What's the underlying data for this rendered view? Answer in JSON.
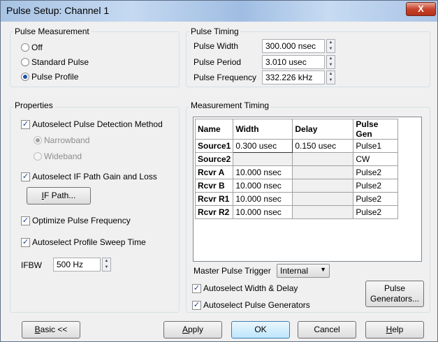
{
  "window": {
    "title": "Pulse Setup: Channel 1",
    "close_glyph": "X"
  },
  "pulse_measurement": {
    "title": "Pulse Measurement",
    "options": [
      {
        "label": "Off",
        "selected": false
      },
      {
        "label": "Standard Pulse",
        "selected": false
      },
      {
        "label": "Pulse Profile",
        "selected": true
      }
    ]
  },
  "pulse_timing": {
    "title": "Pulse Timing",
    "width_label": "Pulse Width",
    "width_value": "300.000 nsec",
    "period_label": "Pulse Period",
    "period_value": "3.010 usec",
    "frequency_label": "Pulse Frequency",
    "frequency_value": "332.226 kHz"
  },
  "properties": {
    "title": "Properties",
    "autoselect_detection": "Autoselect Pulse Detection Method",
    "narrowband": "Narrowband",
    "wideband": "Wideband",
    "autoselect_if": "Autoselect IF Path Gain and Loss",
    "if_path_button_prefix": "I",
    "if_path_button_rest": "F Path...",
    "optimize_frequency": "Optimize Pulse Frequency",
    "autoselect_sweep": "Autoselect Profile Sweep Time",
    "ifbw_label": "IFBW",
    "ifbw_value": "500 Hz"
  },
  "measurement_timing": {
    "title": "Measurement Timing",
    "columns": [
      "Name",
      "Width",
      "Delay",
      "Pulse Gen"
    ],
    "rows": [
      {
        "name": "Source1",
        "width": "0.300 usec",
        "delay": "0.150 usec",
        "gen": "Pulse1"
      },
      {
        "name": "Source2",
        "width": "",
        "delay": "",
        "gen": "CW"
      },
      {
        "name": "Rcvr A",
        "width": "10.000 nsec",
        "delay": "",
        "gen": "Pulse2"
      },
      {
        "name": "Rcvr B",
        "width": "10.000 nsec",
        "delay": "",
        "gen": "Pulse2"
      },
      {
        "name": "Rcvr R1",
        "width": "10.000 nsec",
        "delay": "",
        "gen": "Pulse2"
      },
      {
        "name": "Rcvr R2",
        "width": "10.000 nsec",
        "delay": "",
        "gen": "Pulse2"
      }
    ],
    "trigger_label": "Master Pulse Trigger",
    "trigger_value": "Internal",
    "autoselect_width_delay": "Autoselect Width & Delay",
    "autoselect_generators": "Autoselect Pulse Generators",
    "generators_button_line1": "Pulse",
    "generators_button_line2": "Generators..."
  },
  "footer": {
    "basic_prefix": "B",
    "basic_rest": "asic <<",
    "apply_prefix": "A",
    "apply_rest": "pply",
    "ok": "OK",
    "cancel": "Cancel",
    "help_prefix": "H",
    "help_rest": "elp"
  }
}
